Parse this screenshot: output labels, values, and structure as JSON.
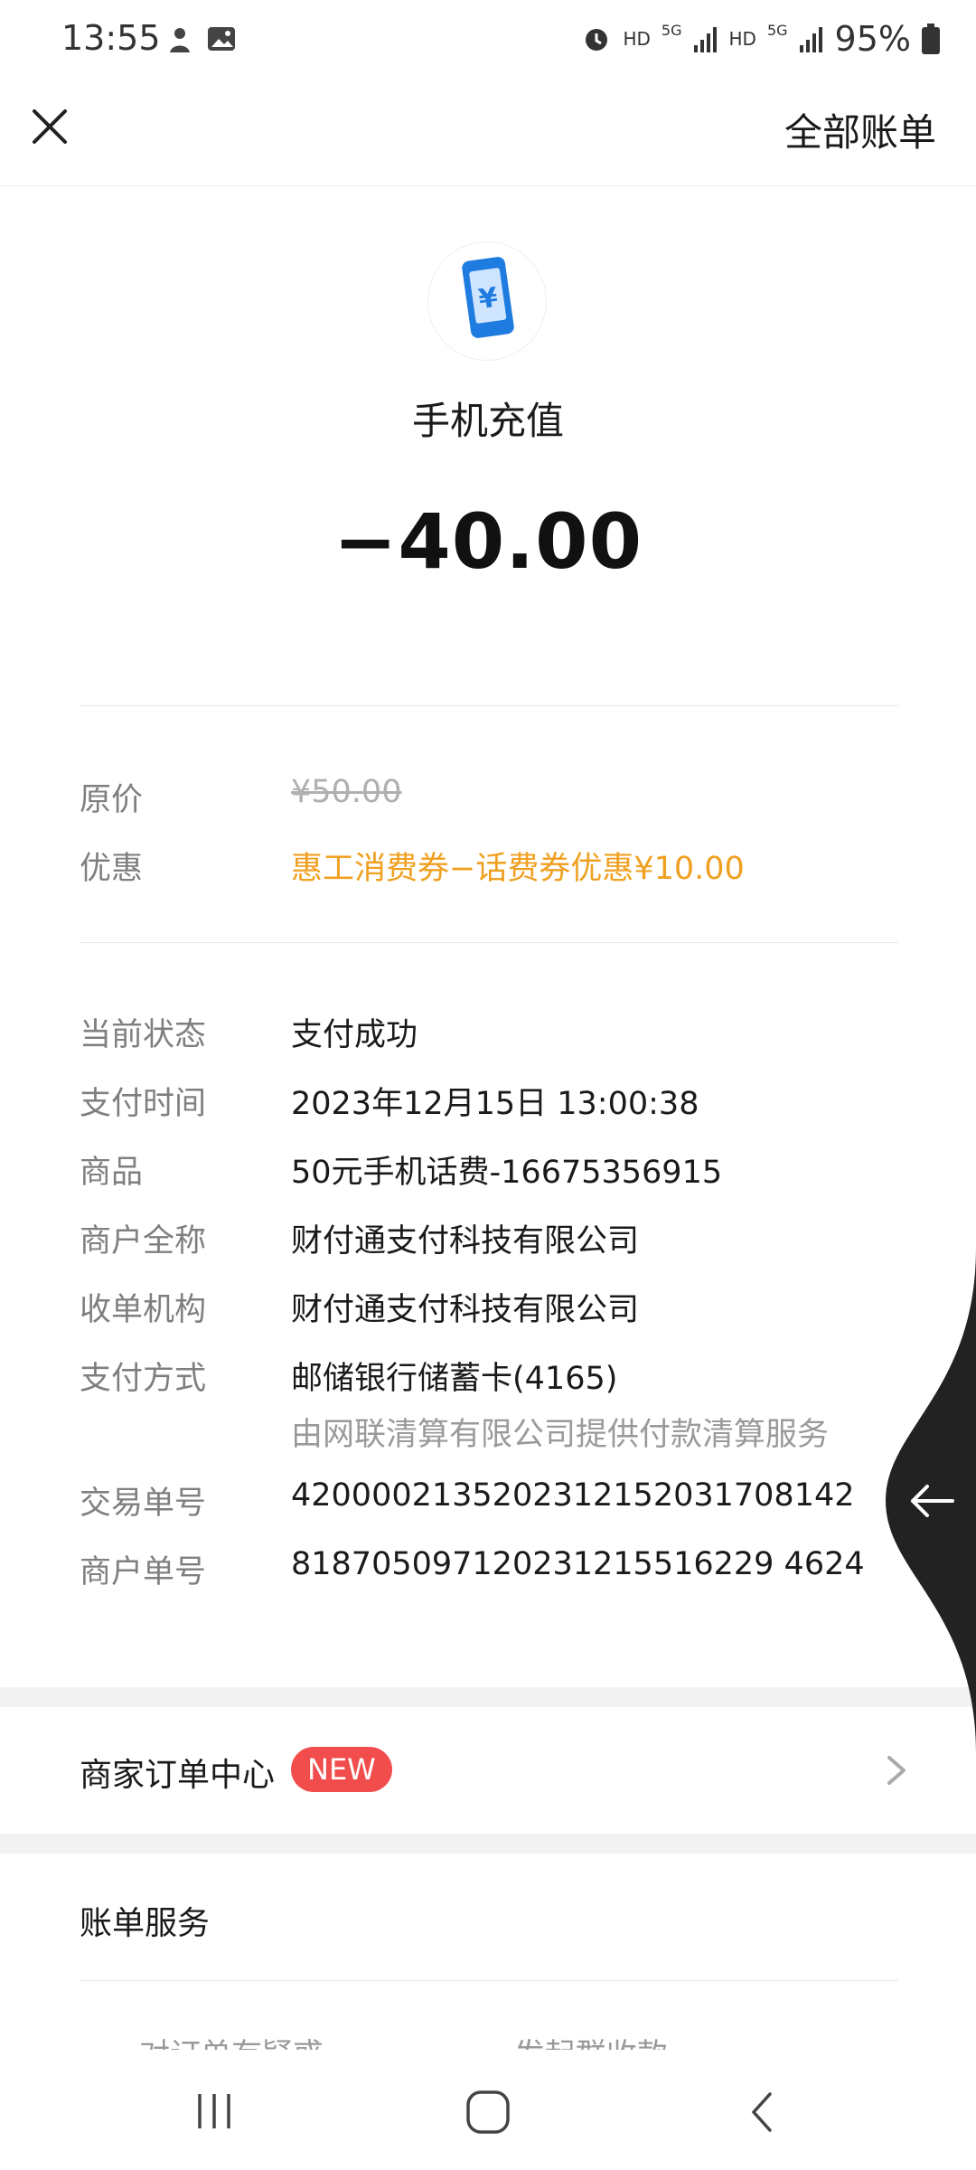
{
  "status": {
    "time": "13:55",
    "battery": "95%",
    "hd1": "HD",
    "hd2": "HD",
    "net1": "5G",
    "net2": "5G"
  },
  "header": {
    "all_bills": "全部账单"
  },
  "transaction": {
    "title": "手机充值",
    "amount": "−40.00"
  },
  "discount": [
    {
      "key": "原价",
      "value": "¥50.00"
    },
    {
      "key": "优惠",
      "value": "惠工消费券−话费券优惠¥10.00"
    }
  ],
  "details": [
    {
      "key": "当前状态",
      "value": "支付成功"
    },
    {
      "key": "支付时间",
      "value": "2023年12月15日 13:00:38"
    },
    {
      "key": "商品",
      "value": "50元手机话费-16675356915"
    },
    {
      "key": "商户全称",
      "value": "财付通支付科技有限公司"
    },
    {
      "key": "收单机构",
      "value": "财付通支付科技有限公司"
    },
    {
      "key": "支付方式",
      "value": "邮储银行储蓄卡(4165)",
      "sub": "由网联清算有限公司提供付款清算服务"
    },
    {
      "key": "交易单号",
      "value": "4200002135202312152031708142"
    },
    {
      "key": "商户单号",
      "value": "818705097120231215516229 4624"
    }
  ],
  "merchant_center": {
    "label": "商家订单中心",
    "badge": "NEW"
  },
  "bill_service": {
    "title": "账单服务",
    "partial_left": "对订单有疑惑",
    "partial_right": "发起群收款"
  },
  "colors": {
    "accent_orange": "#f0a020",
    "badge_red": "#f24d4d",
    "icon_blue": "#1e7be0"
  }
}
